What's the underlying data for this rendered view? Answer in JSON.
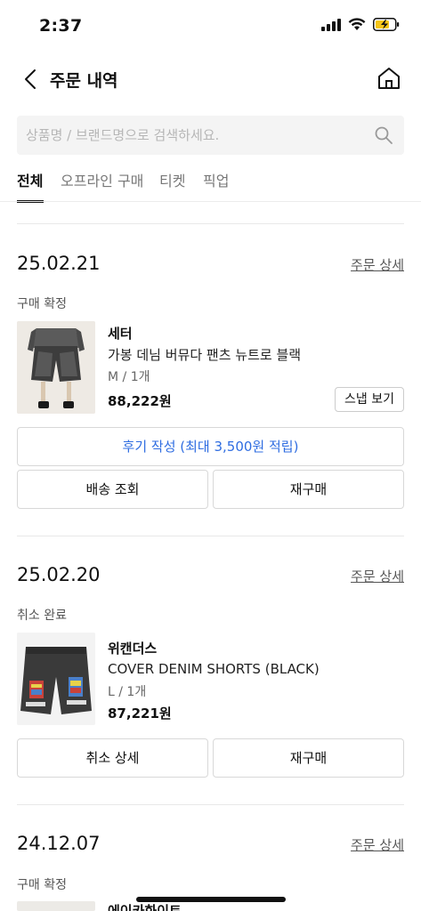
{
  "status_bar": {
    "time": "2:37"
  },
  "header": {
    "title": "주문 내역"
  },
  "search": {
    "placeholder": "상품명 / 브랜드명으로 검색하세요."
  },
  "tabs": [
    {
      "label": "전체",
      "active": true
    },
    {
      "label": "오프라인 구매",
      "active": false
    },
    {
      "label": "티켓",
      "active": false
    },
    {
      "label": "픽업",
      "active": false
    }
  ],
  "orders": [
    {
      "date": "25.02.21",
      "detail_link": "주문 상세",
      "status": "구매 확정",
      "brand": "세터",
      "name": "가봉 데님 버뮤다 팬츠 뉴트로 블랙",
      "option": "M / 1개",
      "price": "88,222원",
      "snap_button": "스냅 보기",
      "review_button": "후기 작성 (최대 3,500원 적립)",
      "left_button": "배송 조회",
      "right_button": "재구매"
    },
    {
      "date": "25.02.20",
      "detail_link": "주문 상세",
      "status": "취소 완료",
      "brand": "위캔더스",
      "name": "COVER DENIM SHORTS (BLACK)",
      "option": "L / 1개",
      "price": "87,221원",
      "left_button": "취소 상세",
      "right_button": "재구매"
    },
    {
      "date": "24.12.07",
      "detail_link": "주문 상세",
      "status": "구매 확정",
      "brand": "에이카화이트"
    }
  ],
  "colors": {
    "accent_blue": "#2f6de1",
    "text_primary": "#111111",
    "text_secondary": "#555555"
  }
}
